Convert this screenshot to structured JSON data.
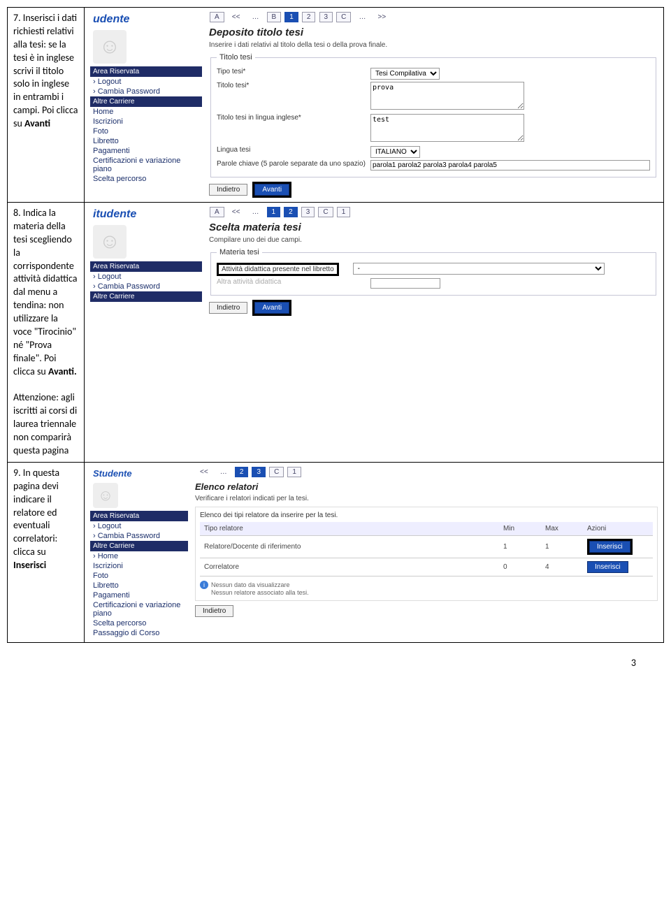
{
  "rows": [
    {
      "instruction_prefix": "7. Inserisci i dati richiesti relativi alla tesi: se la tesi è in inglese scrivi il titolo solo in inglese in entrambi i campi. Poi clicca su ",
      "instruction_bold": "Avanti"
    },
    {
      "instruction_prefix": "8. Indica la materia della tesi scegliendo la corrispondente attività didattica dal menu a tendina: non utilizzare la voce \"Tirocinio\" né \"Prova finale\". Poi clicca su ",
      "instruction_bold": "Avanti.",
      "note": "Attenzione: agli iscritti ai corsi di laurea triennale non comparirà questa pagina"
    },
    {
      "instruction_prefix": "9. In questa pagina devi indicare il relatore ed eventuali correlatori: clicca su ",
      "instruction_bold": "Inserisci"
    }
  ],
  "screen1": {
    "user_title": "udente",
    "area_title": "Area Riservata",
    "logout": "Logout",
    "cambia": "Cambia Password",
    "altre": "Altre Carriere",
    "menu": [
      "Home",
      "Iscrizioni",
      "Foto",
      "Libretto",
      "Pagamenti",
      "Certificazioni e variazione piano",
      "Scelta percorso"
    ],
    "steps": {
      "a": "A",
      "prev": "<<",
      "dots": "…",
      "b": "B",
      "s1": "1",
      "s2": "2",
      "s3": "3",
      "c": "C",
      "dots2": "…",
      "next": ">>"
    },
    "title": "Deposito titolo tesi",
    "sub": "Inserire i dati relativi al titolo della tesi o della prova finale.",
    "legend": "Titolo tesi",
    "f_tipo": "Tipo tesi*",
    "f_tipo_val": "Tesi Compilativa",
    "f_titolo": "Titolo tesi*",
    "f_titolo_val": "prova",
    "f_titolo_en": "Titolo tesi in lingua inglese*",
    "f_titolo_en_val": "test",
    "f_lingua": "Lingua tesi",
    "f_lingua_val": "ITALIANO",
    "f_parole": "Parole chiave (5 parole separate da uno spazio)",
    "f_parole_val": "parola1 parola2 parola3 parola4 parola5",
    "indietro": "Indietro",
    "avanti": "Avanti"
  },
  "screen2": {
    "user_title": "itudente",
    "area_title": "Area Riservata",
    "logout": "Logout",
    "cambia": "Cambia Password",
    "altre": "Altre Carriere",
    "steps": {
      "a": "A",
      "prev": "<<",
      "dots": "…",
      "s1": "1",
      "s2": "2",
      "s3": "3",
      "c": "C",
      "one": "1"
    },
    "title": "Scelta materia tesi",
    "sub": "Compilare uno dei due campi.",
    "legend": "Materia tesi",
    "f_att": "Attività didattica presente nel libretto",
    "f_att_val": "-",
    "f_altra_lbl": "Altra attività didattica",
    "indietro": "Indietro",
    "avanti": "Avanti"
  },
  "screen3": {
    "user_title": "Studente",
    "area_title": "Area Riservata",
    "logout": "Logout",
    "cambia": "Cambia Password",
    "altre": "Altre Carriere",
    "menu": [
      "Home",
      "Iscrizioni",
      "Foto",
      "Libretto",
      "Pagamenti",
      "Certificazioni e variazione piano",
      "Scelta percorso",
      "Passaggio di Corso"
    ],
    "steps": {
      "prev": "<<",
      "dots": "…",
      "s2": "2",
      "s3": "3",
      "c": "C",
      "one": "1"
    },
    "title": "Elenco relatori",
    "sub": "Verificare i relatori indicati per la tesi.",
    "tablecap": "Elenco dei tipi relatore da inserire per la tesi.",
    "th_tipo": "Tipo relatore",
    "th_min": "Min",
    "th_max": "Max",
    "th_az": "Azioni",
    "r1_tipo": "Relatore/Docente di riferimento",
    "r1_min": "1",
    "r1_max": "1",
    "r2_tipo": "Correlatore",
    "r2_min": "0",
    "r2_max": "4",
    "inserisci": "Inserisci",
    "nodata1": "Nessun dato da visualizzare",
    "nodata2": "Nessun relatore associato alla tesi.",
    "indietro": "Indietro"
  },
  "page_number": "3"
}
